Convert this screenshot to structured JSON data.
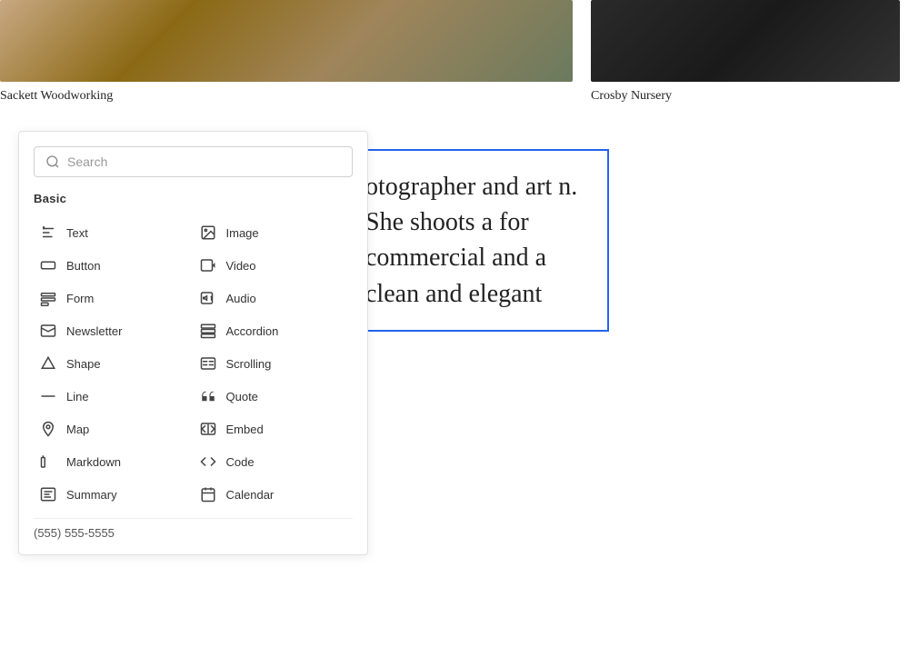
{
  "gallery": {
    "items": [
      {
        "label": "Sackett Woodworking",
        "type": "left"
      },
      {
        "label": "Crosby Nursery",
        "type": "right"
      }
    ]
  },
  "picker": {
    "search_placeholder": "Search",
    "section_label": "Basic",
    "blocks": [
      {
        "id": "text",
        "label": "Text",
        "icon": "text-icon",
        "col": 0
      },
      {
        "id": "image",
        "label": "Image",
        "icon": "image-icon",
        "col": 1
      },
      {
        "id": "button",
        "label": "Button",
        "icon": "button-icon",
        "col": 0
      },
      {
        "id": "video",
        "label": "Video",
        "icon": "video-icon",
        "col": 1
      },
      {
        "id": "form",
        "label": "Form",
        "icon": "form-icon",
        "col": 0
      },
      {
        "id": "audio",
        "label": "Audio",
        "icon": "audio-icon",
        "col": 1
      },
      {
        "id": "newsletter",
        "label": "Newsletter",
        "icon": "newsletter-icon",
        "col": 0
      },
      {
        "id": "accordion",
        "label": "Accordion",
        "icon": "accordion-icon",
        "col": 1
      },
      {
        "id": "shape",
        "label": "Shape",
        "icon": "shape-icon",
        "col": 0
      },
      {
        "id": "scrolling",
        "label": "Scrolling",
        "icon": "scrolling-icon",
        "col": 1
      },
      {
        "id": "line",
        "label": "Line",
        "icon": "line-icon",
        "col": 0
      },
      {
        "id": "quote",
        "label": "Quote",
        "icon": "quote-icon",
        "col": 1
      },
      {
        "id": "map",
        "label": "Map",
        "icon": "map-icon",
        "col": 0
      },
      {
        "id": "embed",
        "label": "Embed",
        "icon": "embed-icon",
        "col": 1
      },
      {
        "id": "markdown",
        "label": "Markdown",
        "icon": "markdown-icon",
        "col": 0
      },
      {
        "id": "code",
        "label": "Code",
        "icon": "code-icon",
        "col": 1
      },
      {
        "id": "summary",
        "label": "Summary",
        "icon": "summary-icon",
        "col": 0
      },
      {
        "id": "calendar",
        "label": "Calendar",
        "icon": "calendar-icon",
        "col": 1
      }
    ],
    "footer_phone": "(555) 555-5555"
  },
  "content": {
    "text": "otographer and art n. She shoots a for commercial and a clean and elegant"
  }
}
